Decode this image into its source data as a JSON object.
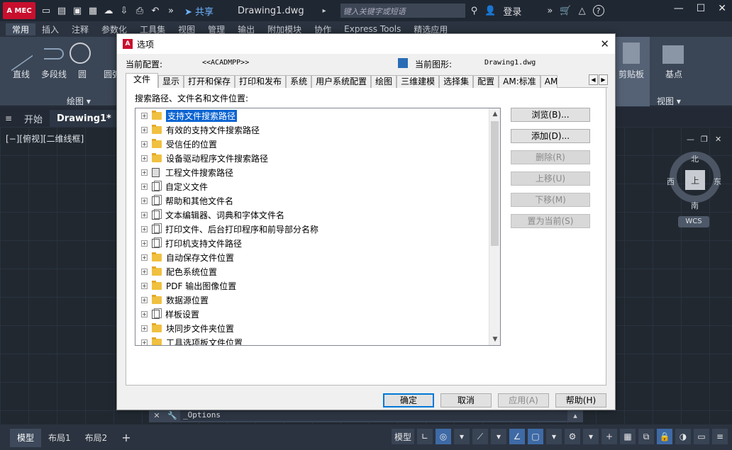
{
  "app": {
    "logo_text": "A MEC",
    "share": "共享",
    "title": "Drawing1.dwg",
    "search_placeholder": "键入关键字或短语",
    "login": "登录",
    "help": "?"
  },
  "ribbon": {
    "tabs": [
      "常用",
      "插入",
      "注释",
      "参数化",
      "工具集",
      "视图",
      "管理",
      "输出",
      "附加模块",
      "协作",
      "Express Tools",
      "精选应用"
    ],
    "active_tab": "常用",
    "tools": [
      "直线",
      "多段线",
      "圆",
      "圆弧"
    ],
    "panels": [
      "绘图 ▾",
      "剪贴板",
      "基点",
      "视图 ▾"
    ]
  },
  "doc_tabs": [
    "开始",
    "Drawing1*"
  ],
  "viewport": {
    "label": "[−][俯视][二维线框]",
    "cube_top": "上",
    "north": "北",
    "south": "南",
    "east": "东",
    "west": "西",
    "wcs": "WCS"
  },
  "command_line": {
    "text": "_Options"
  },
  "statusbar": {
    "layout_tabs": [
      "模型",
      "布局1",
      "布局2"
    ],
    "add": "+",
    "model_button": "模型"
  },
  "dialog": {
    "title": "选项",
    "current_profile_label": "当前配置:",
    "current_profile_value": "<<ACADMPP>>",
    "current_drawing_label": "当前图形:",
    "current_drawing_value": "Drawing1.dwg",
    "tabs": [
      "文件",
      "显示",
      "打开和保存",
      "打印和发布",
      "系统",
      "用户系统配置",
      "绘图",
      "三维建模",
      "选择集",
      "配置",
      "AM:标准",
      "AM:结"
    ],
    "active_tab": "文件",
    "panel_label": "搜索路径、文件名和文件位置:",
    "tree_items": [
      {
        "label": "支持文件搜索路径",
        "icon": "folder-icon",
        "selected": true
      },
      {
        "label": "有效的支持文件搜索路径",
        "icon": "folder-icon"
      },
      {
        "label": "受信任的位置",
        "icon": "folder-icon"
      },
      {
        "label": "设备驱动程序文件搜索路径",
        "icon": "folder-icon"
      },
      {
        "label": "工程文件搜索路径",
        "icon": "file-icon"
      },
      {
        "label": "自定义文件",
        "icon": "document-icon"
      },
      {
        "label": "帮助和其他文件名",
        "icon": "document-icon"
      },
      {
        "label": "文本编辑器、词典和字体文件名",
        "icon": "document-icon"
      },
      {
        "label": "打印文件、后台打印程序和前导部分名称",
        "icon": "document-icon"
      },
      {
        "label": "打印机支持文件路径",
        "icon": "document-icon"
      },
      {
        "label": "自动保存文件位置",
        "icon": "folder-icon"
      },
      {
        "label": "配色系统位置",
        "icon": "folder-icon"
      },
      {
        "label": "PDF 输出图像位置",
        "icon": "folder-icon"
      },
      {
        "label": "数据源位置",
        "icon": "folder-icon"
      },
      {
        "label": "样板设置",
        "icon": "document-icon"
      },
      {
        "label": "块同步文件夹位置",
        "icon": "folder-icon"
      },
      {
        "label": "工具选项板文件位置",
        "icon": "folder-icon"
      }
    ],
    "side_buttons": [
      {
        "label": "浏览(B)...",
        "enabled": true
      },
      {
        "label": "添加(D)...",
        "enabled": true
      },
      {
        "label": "删除(R)",
        "enabled": false
      },
      {
        "label": "上移(U)",
        "enabled": false
      },
      {
        "label": "下移(M)",
        "enabled": false
      },
      {
        "label": "置为当前(S)",
        "enabled": false
      }
    ],
    "footer_buttons": [
      {
        "label": "确定",
        "enabled": true,
        "primary": true
      },
      {
        "label": "取消",
        "enabled": true
      },
      {
        "label": "应用(A)",
        "enabled": false
      },
      {
        "label": "帮助(H)",
        "enabled": true
      }
    ]
  }
}
